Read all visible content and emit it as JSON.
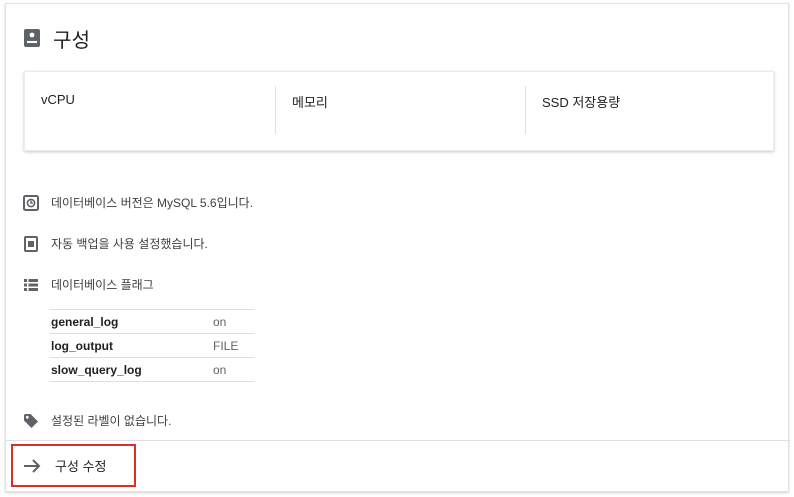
{
  "header": {
    "icon": "storage-icon",
    "title": "구성"
  },
  "specs": {
    "vcpu_label": "vCPU",
    "memory_label": "메모리",
    "ssd_label": "SSD 저장용량"
  },
  "info": {
    "db_version": {
      "icon": "history-icon",
      "text": "데이터베이스 버전은 MySQL 5.6입니다."
    },
    "backup": {
      "icon": "backup-icon",
      "text": "자동 백업을 사용 설정했습니다."
    },
    "flags": {
      "icon": "list-icon",
      "text": "데이터베이스 플래그"
    },
    "labels": {
      "icon": "label-icon",
      "text": "설정된 라벨이 없습니다."
    }
  },
  "flags_table": [
    {
      "name": "general_log",
      "value": "on"
    },
    {
      "name": "log_output",
      "value": "FILE"
    },
    {
      "name": "slow_query_log",
      "value": "on"
    }
  ],
  "footer": {
    "edit_icon": "arrow-right-icon",
    "edit_label": "구성 수정"
  },
  "colors": {
    "highlight": "#d93025",
    "icon": "#5f6368"
  }
}
